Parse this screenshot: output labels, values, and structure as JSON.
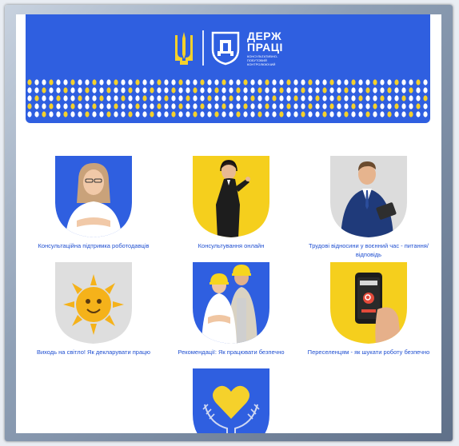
{
  "header": {
    "brand_line1": "ДЕРЖ",
    "brand_line2": "ПРАЦІ",
    "brand_tagline": "КОНСУЛЬТАТИВНО-ПОБУТОВИЙ КОНТРОЛЮЮЧИЙ",
    "accent_blue": "#2f5fe0",
    "accent_yellow": "#f5d12b"
  },
  "tiles": [
    {
      "caption": "Консультаційна підтримка роботодавців",
      "icon": "businesswoman-photo",
      "bg": "#2f5fe0"
    },
    {
      "caption": "Консультування онлайн",
      "icon": "call-center-operator-photo",
      "bg": "#f5cf1d"
    },
    {
      "caption": "Трудові відносини у воєнний час - питання/відповідь",
      "icon": "businessman-photo",
      "bg": "#d9d9d9"
    },
    {
      "caption": "Виходь на світло! Як декларувати працю",
      "icon": "sun-character-icon",
      "bg": "#d9d9d9"
    },
    {
      "caption": "Рекомендації: Як працювати безпечно",
      "icon": "workers-in-helmets-photo",
      "bg": "#2f5fe0"
    },
    {
      "caption": "Переселенцям - як шукати роботу безпечно",
      "icon": "phone-in-hand-photo",
      "bg": "#f5cf1d"
    },
    {
      "caption": "",
      "icon": "heart-in-hands-icon",
      "bg": "#2f5fe0"
    }
  ]
}
